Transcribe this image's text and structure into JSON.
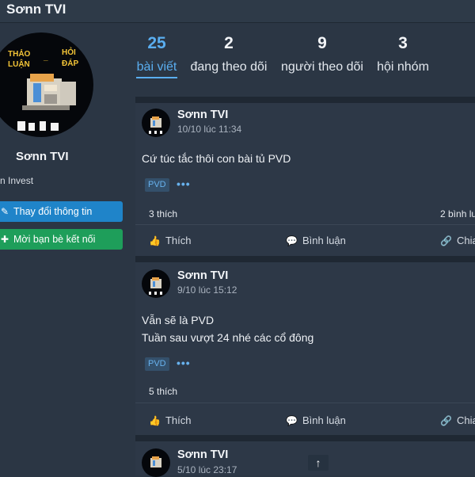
{
  "header": {
    "title": "Sơnn TVI"
  },
  "profile": {
    "name": "Sơnn TVI",
    "org": "n Invest",
    "avatar_words": [
      "THẢO",
      "LUẬN",
      "_",
      "HỎI",
      "ĐÁP"
    ],
    "buttons": {
      "edit": "Thay đổi thông tin",
      "invite": "Mời bạn bè kết nối"
    }
  },
  "stats": [
    {
      "num": "25",
      "label": "bài viết"
    },
    {
      "num": "2",
      "label": "đang theo dõi"
    },
    {
      "num": "9",
      "label": "người theo dõi"
    },
    {
      "num": "3",
      "label": "hội nhóm"
    }
  ],
  "posts": [
    {
      "author": "Sơnn TVI",
      "time": "10/10 lúc 11:34",
      "lines": [
        "Cứ túc tắc thôi con bài tủ PVD"
      ],
      "tag": "PVD",
      "likes": "3 thích",
      "comments": "2 bình lu",
      "actions": {
        "like": "Thích",
        "comment": "Bình luận",
        "share": "Chia"
      }
    },
    {
      "author": "Sơnn TVI",
      "time": "9/10 lúc 15:12",
      "lines": [
        "Vẫn sẽ là PVD",
        "Tuần sau vượt 24 nhé các cổ đông"
      ],
      "tag": "PVD",
      "likes": "5 thích",
      "comments": "",
      "actions": {
        "like": "Thích",
        "comment": "Bình luận",
        "share": "Chia"
      }
    },
    {
      "author": "Sơnn TVI",
      "time": "5/10 lúc 23:17"
    }
  ],
  "icons": {
    "pencil": "pencil-icon",
    "add_user": "add-user-icon",
    "like": "thumbs-up-icon",
    "comment": "comment-icon",
    "share": "link-icon",
    "scroll_top": "arrow-up-icon",
    "more": "more-dots-icon"
  },
  "colors": {
    "accent": "#5aaef0",
    "blue_button": "#1f84c9",
    "green_button": "#1e9e5a",
    "background": "#2b3644"
  }
}
